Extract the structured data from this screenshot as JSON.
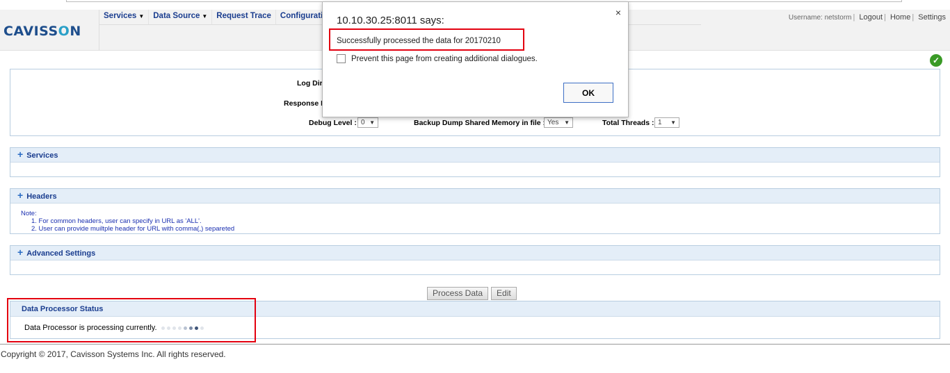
{
  "header": {
    "logo_prefix": "CAVISS",
    "logo_o": "O",
    "logo_suffix": "N",
    "nav": [
      {
        "label": "Services",
        "caret": "▼"
      },
      {
        "label": "Data Source",
        "caret": "▼"
      },
      {
        "label": "Request Trace"
      },
      {
        "label": "Configurati"
      }
    ],
    "user": {
      "username_label": "Username: netstorm",
      "logout": "Logout",
      "home": "Home",
      "settings": "Settings",
      "separator": "|"
    }
  },
  "form": {
    "log_dir_label": "Log Dir",
    "response_label": "Response D",
    "debug_level_label": "Debug Level :",
    "debug_level_value": "0",
    "backup_label": "Backup Dump Shared Memory in file :",
    "backup_value": "Yes",
    "threads_label": "Total Threads :",
    "threads_value": "1"
  },
  "sections": {
    "services": "Services",
    "headers": "Headers",
    "advanced": "Advanced Settings",
    "note_title": "Note:",
    "note_1": "1. For common headers, user can specify in URL as 'ALL'.",
    "note_2": "2. User can provide muiltple header for URL with comma(,) separeted"
  },
  "buttons": {
    "process": "Process Data",
    "edit": "Edit"
  },
  "status": {
    "title": "Data Processor Status",
    "message": "Data Processor is processing currently."
  },
  "footer": "Copyright © 2017, Cavisson Systems Inc. All rights reserved.",
  "dialog": {
    "title": "10.10.30.25:8011 says:",
    "message": "Successfully processed the data for 20170210",
    "prevent_label": "Prevent this page from creating additional dialogues.",
    "ok": "OK",
    "close": "×"
  },
  "colors": {
    "accent_blue": "#1a3d8f",
    "highlight_red": "#e3000f",
    "success_green": "#3a9a26"
  }
}
